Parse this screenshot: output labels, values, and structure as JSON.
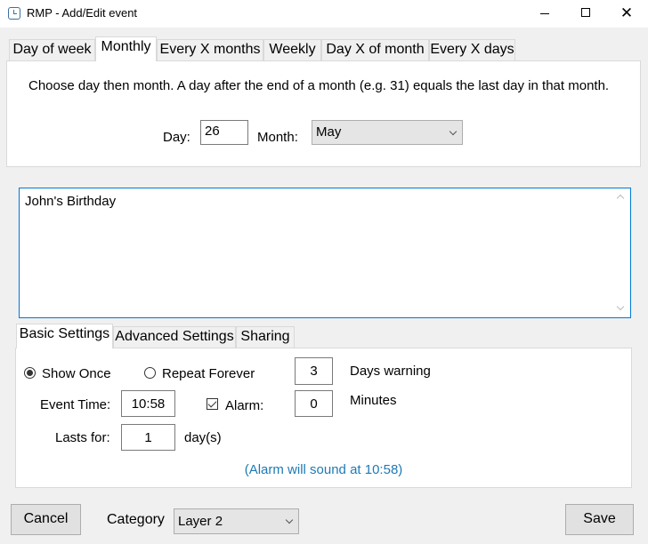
{
  "window": {
    "title": "RMP - Add/Edit event",
    "minimize_label": "",
    "maximize_label": "",
    "close_label": "✕"
  },
  "schedule_tabs": [
    {
      "label": "Day of week"
    },
    {
      "label": "Monthly",
      "active": true
    },
    {
      "label": "Every X months"
    },
    {
      "label": "Weekly"
    },
    {
      "label": "Day X of month"
    },
    {
      "label": "Every X days"
    }
  ],
  "monthly": {
    "description": "Choose day then month.  A day after the end of a month (e.g. 31) equals the last day in that month.",
    "day_label": "Day:",
    "day_value": "26",
    "month_label": "Month:",
    "month_value": "May"
  },
  "event_text": "John's Birthday",
  "settings_tabs": [
    {
      "label": "Basic Settings",
      "active": true
    },
    {
      "label": "Advanced Settings"
    },
    {
      "label": "Sharing"
    }
  ],
  "basic": {
    "show_once_label": "Show Once",
    "show_once_checked": true,
    "repeat_forever_label": "Repeat Forever",
    "repeat_forever_checked": false,
    "days_warning_value": "3",
    "days_warning_label": "Days warning",
    "event_time_label": "Event Time:",
    "event_time_value": "10:58",
    "alarm_label": "Alarm:",
    "alarm_checked": true,
    "alarm_minutes_value": "0",
    "minutes_label": "Minutes",
    "lasts_for_label": "Lasts for:",
    "lasts_for_value": "1",
    "days_unit_label": "day(s)",
    "alarm_note": "(Alarm will sound at 10:58)"
  },
  "footer": {
    "cancel_label": "Cancel",
    "category_label": "Category",
    "category_value": "Layer 2",
    "save_label": "Save"
  },
  "colors": {
    "accent": "#0078d7",
    "note": "#1e7ab4"
  }
}
